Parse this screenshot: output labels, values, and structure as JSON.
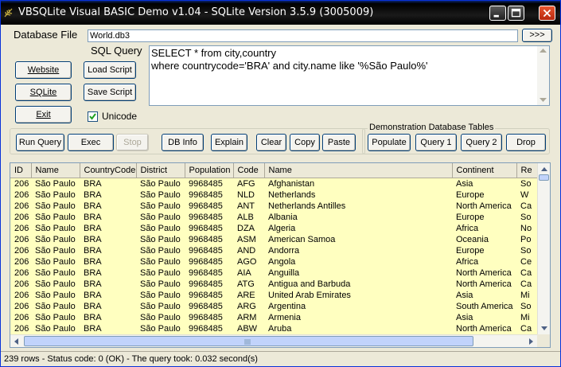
{
  "window": {
    "title": "VBSQLite Visual BASIC Demo v1.04 - SQLite Version 3.5.9 (3005009)"
  },
  "database": {
    "label": "Database File",
    "value": "World.db3",
    "browse_label": ">>>"
  },
  "query": {
    "label": "SQL Query",
    "line1": "SELECT * from city,country",
    "line2": "where countrycode='BRA' and city.name like '%São Paulo%'"
  },
  "side_buttons": {
    "website": "Website",
    "load_script": "Load Script",
    "sqlite": "SQLite",
    "save_script": "Save Script",
    "exit": "Exit",
    "unicode_label": "Unicode",
    "unicode_checked": true
  },
  "toolbar": {
    "run_query": "Run Query",
    "exec": "Exec",
    "stop": "Stop",
    "db_info": "DB Info",
    "explain": "Explain",
    "clear": "Clear",
    "copy": "Copy",
    "paste": "Paste"
  },
  "demo_group": {
    "legend": "Demonstration Database Tables",
    "populate": "Populate",
    "query1": "Query 1",
    "query2": "Query 2",
    "drop": "Drop"
  },
  "grid": {
    "columns": [
      "ID",
      "Name",
      "CountryCode",
      "District",
      "Population",
      "Code",
      "Name",
      "Continent",
      "Re"
    ],
    "rows": [
      [
        "206",
        "São Paulo",
        "BRA",
        "São Paulo",
        "9968485",
        "AFG",
        "Afghanistan",
        "Asia",
        "So"
      ],
      [
        "206",
        "São Paulo",
        "BRA",
        "São Paulo",
        "9968485",
        "NLD",
        "Netherlands",
        "Europe",
        "W"
      ],
      [
        "206",
        "São Paulo",
        "BRA",
        "São Paulo",
        "9968485",
        "ANT",
        "Netherlands Antilles",
        "North America",
        "Ca"
      ],
      [
        "206",
        "São Paulo",
        "BRA",
        "São Paulo",
        "9968485",
        "ALB",
        "Albania",
        "Europe",
        "So"
      ],
      [
        "206",
        "São Paulo",
        "BRA",
        "São Paulo",
        "9968485",
        "DZA",
        "Algeria",
        "Africa",
        "No"
      ],
      [
        "206",
        "São Paulo",
        "BRA",
        "São Paulo",
        "9968485",
        "ASM",
        "American Samoa",
        "Oceania",
        "Po"
      ],
      [
        "206",
        "São Paulo",
        "BRA",
        "São Paulo",
        "9968485",
        "AND",
        "Andorra",
        "Europe",
        "So"
      ],
      [
        "206",
        "São Paulo",
        "BRA",
        "São Paulo",
        "9968485",
        "AGO",
        "Angola",
        "Africa",
        "Ce"
      ],
      [
        "206",
        "São Paulo",
        "BRA",
        "São Paulo",
        "9968485",
        "AIA",
        "Anguilla",
        "North America",
        "Ca"
      ],
      [
        "206",
        "São Paulo",
        "BRA",
        "São Paulo",
        "9968485",
        "ATG",
        "Antigua and Barbuda",
        "North America",
        "Ca"
      ],
      [
        "206",
        "São Paulo",
        "BRA",
        "São Paulo",
        "9968485",
        "ARE",
        "United Arab Emirates",
        "Asia",
        "Mi"
      ],
      [
        "206",
        "São Paulo",
        "BRA",
        "São Paulo",
        "9968485",
        "ARG",
        "Argentina",
        "South America",
        "So"
      ],
      [
        "206",
        "São Paulo",
        "BRA",
        "São Paulo",
        "9968485",
        "ARM",
        "Armenia",
        "Asia",
        "Mi"
      ],
      [
        "206",
        "São Paulo",
        "BRA",
        "São Paulo",
        "9968485",
        "ABW",
        "Aruba",
        "North America",
        "Ca"
      ]
    ]
  },
  "status": {
    "text": "239 rows - Status code: 0 (OK) - The query took: 0.032 second(s)"
  },
  "icons": {
    "app": "sqlite-feather-icon",
    "minimize": "minimize-icon",
    "maximize": "maximize-icon",
    "close": "close-icon"
  }
}
